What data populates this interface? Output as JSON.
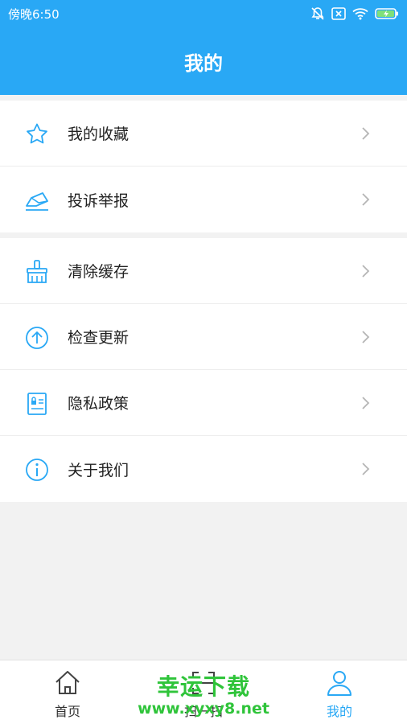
{
  "status_bar": {
    "time": "傍晚6:50"
  },
  "header": {
    "title": "我的"
  },
  "menu": {
    "group1": [
      {
        "label": "我的收藏",
        "icon": "star-icon"
      },
      {
        "label": "投诉举报",
        "icon": "report-envelope-icon"
      }
    ],
    "group2": [
      {
        "label": "清除缓存",
        "icon": "broom-icon"
      },
      {
        "label": "检查更新",
        "icon": "upload-arrow-icon"
      },
      {
        "label": "隐私政策",
        "icon": "privacy-document-icon"
      },
      {
        "label": "关于我们",
        "icon": "info-icon"
      }
    ]
  },
  "tabbar": {
    "items": [
      {
        "label": "首页",
        "icon": "home-icon",
        "active": false
      },
      {
        "label": "扫一扫",
        "icon": "scan-icon",
        "active": false
      },
      {
        "label": "我的",
        "icon": "person-icon",
        "active": true
      }
    ]
  },
  "watermark": {
    "title": "幸运下载",
    "url": "www.xyxy8.net"
  },
  "colors": {
    "accent": "#29a8f5",
    "background": "#f2f2f2",
    "watermark": "#2fc43a"
  }
}
